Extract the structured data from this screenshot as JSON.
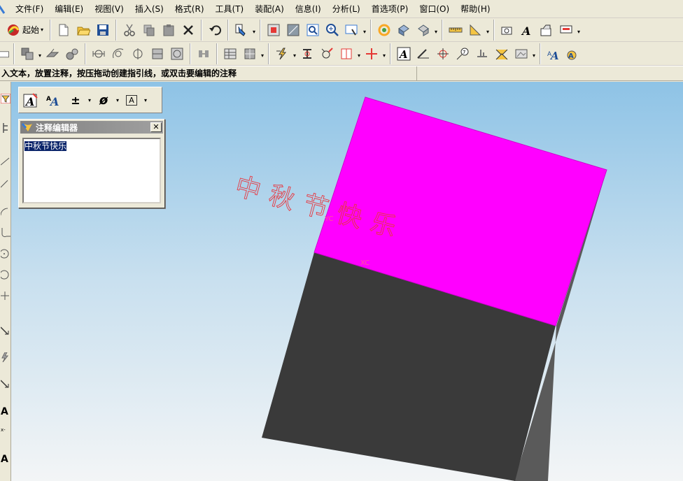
{
  "menu": [
    "文件(F)",
    "编辑(E)",
    "视图(V)",
    "插入(S)",
    "格式(R)",
    "工具(T)",
    "装配(A)",
    "信息(I)",
    "分析(L)",
    "首选项(P)",
    "窗口(O)",
    "帮助(H)"
  ],
  "toolbar": {
    "start_label": "起始"
  },
  "cue_line": "入文本，放置注释，按压拖动创建指引线，或双击要编辑的注释",
  "status_line": "",
  "annotation_toolbar": {
    "tolerance_symbol": "±",
    "diameter_symbol": "ø",
    "text_box_symbol": "A"
  },
  "annotation_editor": {
    "title": "注释编辑器",
    "text": "中秋节快乐"
  },
  "viewport": {
    "annotation_text": "中秋节快乐",
    "wcs_label_upper": "YC",
    "wcs_label_lower": "XC"
  },
  "colors": {
    "top_face": "#ff00ff",
    "front_face": "#3a3a3a",
    "annotation": "#e8373f",
    "cue_text": "#000000"
  },
  "icons": {
    "app": "nx-app-icon",
    "tb1": [
      "start-icon",
      "new-icon",
      "open-icon",
      "save-icon",
      "cut-icon",
      "copy-icon",
      "paste-icon",
      "delete-icon",
      "undo-icon",
      "selection-icon",
      "fit-icon",
      "zoom-window-icon",
      "zoom-icon",
      "zoom-in-out-icon",
      "pan-icon",
      "rotate-icon",
      "shaded-icon",
      "wireframe-icon",
      "measure-distance-icon",
      "measure-angle-icon",
      "view-camera-icon",
      "text-style-icon",
      "annotation-icon",
      "display-icon"
    ],
    "tb2": [
      "sheet-icon",
      "view-layout-icon",
      "section-view-icon",
      "detail-view-icon",
      "dimension-icon",
      "angular-dimension-icon",
      "radius-dimension-icon",
      "baseline-dimension-icon",
      "ordinate-dimension-icon",
      "chain-dimension-icon",
      "table-icon",
      "parts-list-icon",
      "weld-symbol-icon",
      "feature-control-frame-icon",
      "datum-icon",
      "centerline-icon",
      "crosshair-icon",
      "note-icon",
      "leader-icon",
      "target-point-icon",
      "id-symbol-icon",
      "surface-finish-icon",
      "weld-icon",
      "image-icon",
      "annotation-style-icon",
      "settings-icon"
    ]
  }
}
